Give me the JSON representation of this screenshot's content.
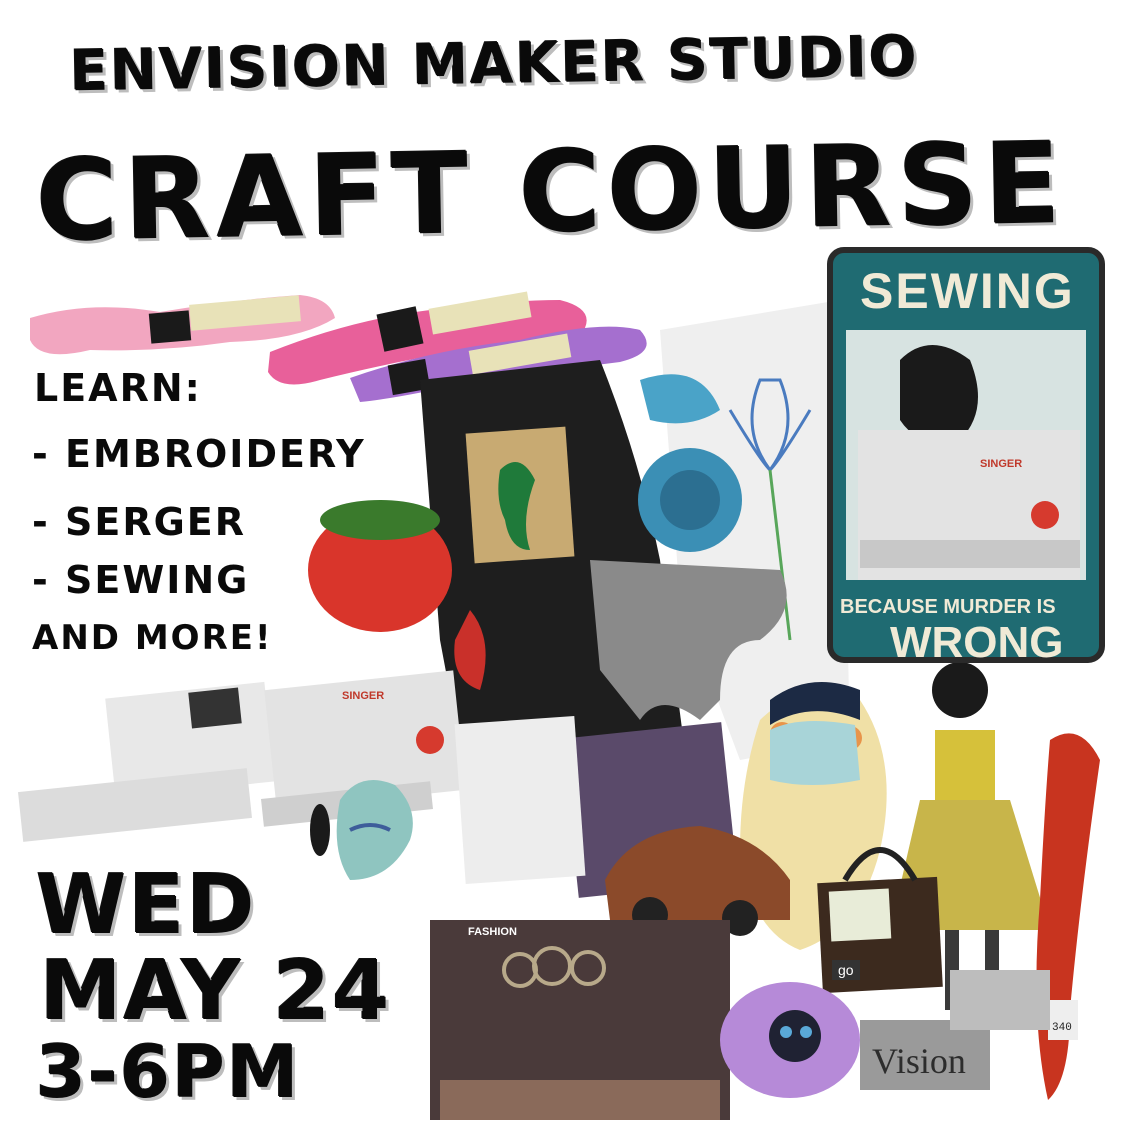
{
  "poster": {
    "title_line1": "ENVISION MAKER STUDIO",
    "title_line2": "CRAFT COURSE",
    "learn_heading": "LEARN:",
    "topics": [
      "- EMBROIDERY",
      "- SERGER",
      "- SEWING"
    ],
    "more": "AND MORE!",
    "day": "WED",
    "date": "MAY 24",
    "time": "3-6PM"
  },
  "sign": {
    "title": "SEWING",
    "caption_line1": "BECAUSE MURDER IS",
    "caption_line2": "WRONG"
  },
  "labels": {
    "singer_brand": "SINGER",
    "singer_brand_2": "SINGER",
    "vision_sign": "Vision",
    "thread_number": "340",
    "bag_tag": "go",
    "fashion_tag": "FASHION"
  },
  "colors": {
    "sign_teal": "#1f6b72",
    "sign_text": "#f0ead6",
    "thread_pink": "#f2a6c0",
    "thread_magenta": "#e8609a",
    "thread_purple": "#a56fcf",
    "thread_red": "#c8341f",
    "pincushion_red": "#d9352b"
  },
  "icons": [
    "cat-icon",
    "sewing-machine-icon",
    "butterfly-icon",
    "pincushion-icon",
    "car-patch-icon",
    "spider-patch-icon"
  ]
}
